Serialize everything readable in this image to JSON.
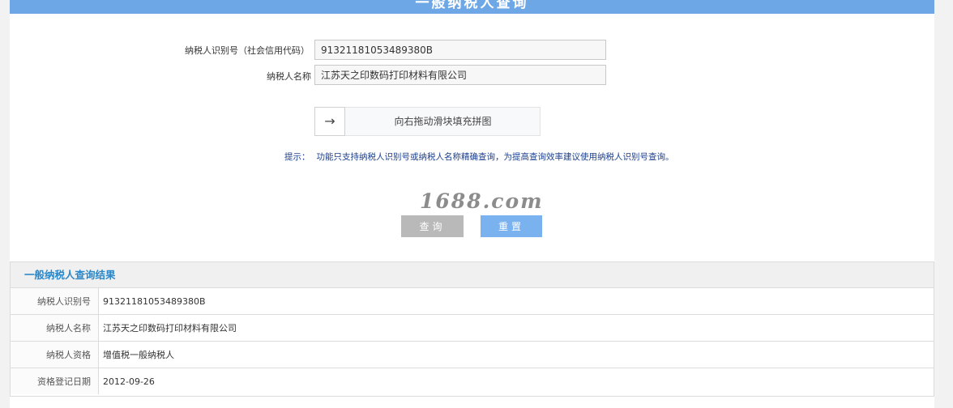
{
  "header": {
    "title": "一般纳税人查询"
  },
  "form": {
    "taxpayer_id_label": "纳税人识别号（社会信用代码）",
    "taxpayer_id_value": "91321181053489380B",
    "taxpayer_name_label": "纳税人名称",
    "taxpayer_name_value": "江苏天之印数码打印材料有限公司"
  },
  "slider": {
    "arrow": "→",
    "instruction": "向右拖动滑块填充拼图"
  },
  "hint": {
    "label": "提示：",
    "text": "功能只支持纳税人识别号或纳税人名称精确查询，为提高查询效率建议使用纳税人识别号查询。"
  },
  "watermark": "1688.com",
  "buttons": {
    "query_label": "查询",
    "reset_label": "重置"
  },
  "results": {
    "title": "一般纳税人查询结果",
    "rows": [
      {
        "label": "纳税人识别号",
        "value": "91321181053489380B"
      },
      {
        "label": "纳税人名称",
        "value": "江苏天之印数码打印材料有限公司"
      },
      {
        "label": "纳税人资格",
        "value": "增值税一般纳税人"
      },
      {
        "label": "资格登记日期",
        "value": "2012-09-26"
      }
    ]
  },
  "colors": {
    "header_bar": "#6ea7e6",
    "reset_button": "#7ab2ef",
    "query_button": "#b9b9b9",
    "result_title": "#2b87c8",
    "hint_text": "#1b3f8f"
  }
}
